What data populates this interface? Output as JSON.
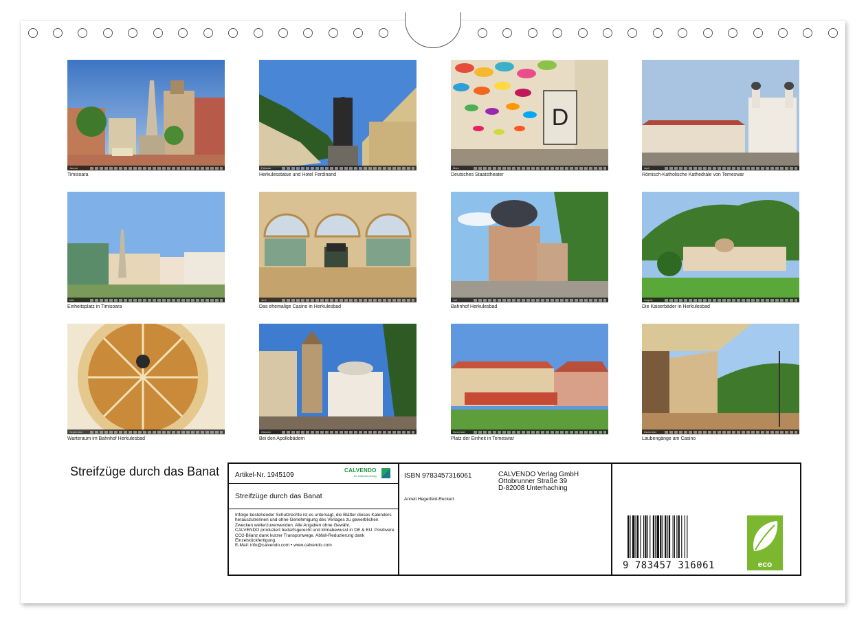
{
  "colors": {
    "eco_green": "#7cb82f",
    "calvendo_green": "#1b8f3c",
    "frame": "#111111"
  },
  "photos": [
    {
      "month": "Januar",
      "caption": "Timisoara"
    },
    {
      "month": "Februar",
      "caption": "Herkulesstatue und Hotel Ferdinand"
    },
    {
      "month": "März",
      "caption": "Deutsches Staatstheater"
    },
    {
      "month": "April",
      "caption": "Römisch-Katholische Kathedrale von Temeswar"
    },
    {
      "month": "Mai",
      "caption": "Einheitsplatz in Timisoara"
    },
    {
      "month": "Juni",
      "caption": "Das ehemalige Casino in Herkulesbad"
    },
    {
      "month": "Juli",
      "caption": "Bahnhof Herkulesbad"
    },
    {
      "month": "August",
      "caption": "Die Kaiserbäder in Herkulesbad"
    },
    {
      "month": "September",
      "caption": "Warteraum im Bahnhof Herkulesbad"
    },
    {
      "month": "Oktober",
      "caption": "Bei den Apollobädern"
    },
    {
      "month": "November",
      "caption": "Platz der Einheit in Temeswar"
    },
    {
      "month": "Dezember",
      "caption": "Laubengänge am Casino"
    }
  ],
  "cover_title": "Streifzüge durch das Banat",
  "info": {
    "article": "Artikel-Nr. 1945109",
    "calvendo_logo": "CALVENDO",
    "calvendo_sub": "Ihr Kalenderverlag",
    "title": "Streifzüge durch das Banat",
    "legal": "Infolge bestehender Schutzrechte ist es untersagt, die Blätter dieses Kalenders herauszutrennen und ohne Genehmigung des Verlages zu gewerblichen Zwecken weiterzuverwenden. Alle Angaben ohne Gewähr.\nCALVENDO produziert bedarfsgerecht und klimabewusst in DE & EU. Positivere CO2-Bilanz dank kurzer Transportwege. Abfall-Reduzierung dank Einzelstückfertigung.\nE-Mail: info@calvendo.com • www.calvendo.com",
    "isbn": "ISBN 9783457316061",
    "author": "Anneli Hegerfeld-Reckert",
    "publisher_name": "CALVENDO Verlag GmbH",
    "publisher_street": "Ottobrunner Straße 39",
    "publisher_city": "D-82008 Unterhaching",
    "barcode_number": "9 783457 316061",
    "eco_label": "eco"
  }
}
